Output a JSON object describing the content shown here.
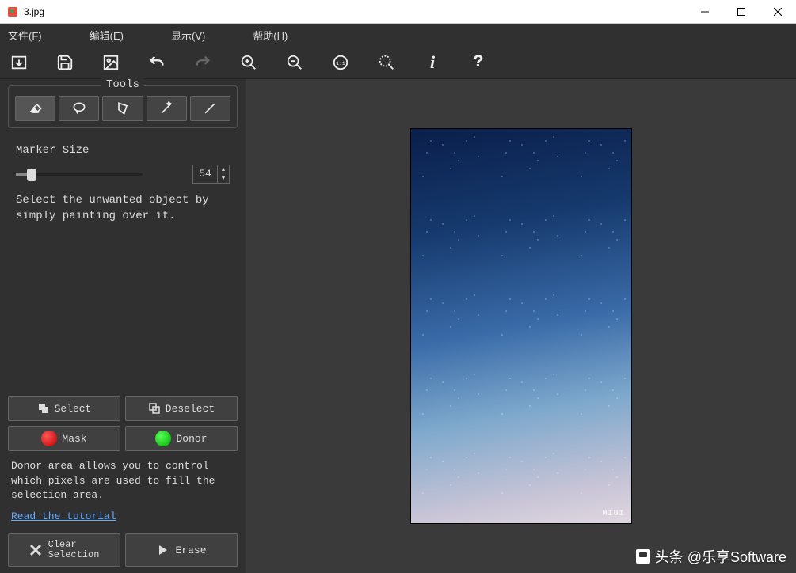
{
  "window": {
    "title": "3.jpg"
  },
  "menu": {
    "file": "文件(F)",
    "edit": "编辑(E)",
    "view": "显示(V)",
    "help": "帮助(H)"
  },
  "sidebar": {
    "tools_label": "Tools",
    "marker_label": "Marker Size",
    "marker_value": "54",
    "marker_help": "Select the unwanted object by simply painting over it.",
    "select_btn": "Select",
    "deselect_btn": "Deselect",
    "mask_btn": "Mask",
    "donor_btn": "Donor",
    "donor_help": "Donor area allows you to control which pixels are used to fill the selection area.",
    "tutorial": "Read the tutorial",
    "clear_btn1": "Clear",
    "clear_btn2": "Selection",
    "erase_btn": "Erase"
  },
  "preview": {
    "badge": "MIUI"
  },
  "watermark": {
    "text": "头条 @乐享Software"
  }
}
